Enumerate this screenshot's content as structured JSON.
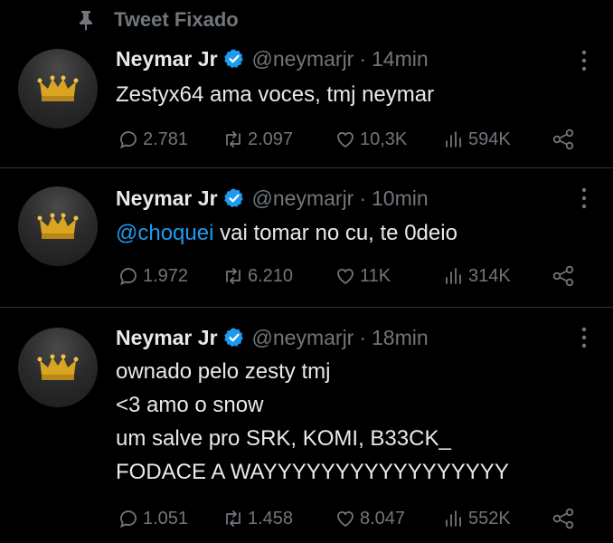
{
  "pinned_label": "Tweet Fixado",
  "tweets": [
    {
      "name": "Neymar Jr",
      "handle": "@neymarjr",
      "separator": "·",
      "time": "14min",
      "lines": [
        "Zestyx64 ama voces, tmj neymar"
      ],
      "replies": "2.781",
      "retweets": "2.097",
      "likes": "10,3K",
      "views": "594K"
    },
    {
      "name": "Neymar Jr",
      "handle": "@neymarjr",
      "separator": "·",
      "time": "10min",
      "mention": "@choquei",
      "text_after_mention": " vai tomar no cu, te 0deio",
      "replies": "1.972",
      "retweets": "6.210",
      "likes": "11K",
      "views": "314K"
    },
    {
      "name": "Neymar Jr",
      "handle": "@neymarjr",
      "separator": "·",
      "time": "18min",
      "lines": [
        "ownado pelo zesty tmj",
        "<3 amo o snow",
        "um salve pro SRK, KOMI, B33CK_",
        "FODACE A WAYYYYYYYYYYYYYYYYY"
      ],
      "replies": "1.051",
      "retweets": "1.458",
      "likes": "8.047",
      "views": "552K"
    }
  ],
  "icons": {
    "pin": "pin-icon",
    "verified": "verified-badge-icon",
    "more": "more-vertical-icon",
    "reply": "reply-icon",
    "retweet": "retweet-icon",
    "like": "heart-icon",
    "views": "views-chart-icon",
    "share": "share-icon"
  },
  "colors": {
    "background": "#000000",
    "text": "#e7e9ea",
    "secondary": "#71767b",
    "link": "#1d9bf0",
    "verified": "#1d9bf0",
    "divider": "#2f3336"
  }
}
